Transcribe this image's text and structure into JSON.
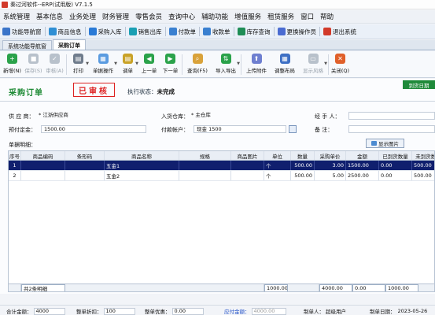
{
  "window": {
    "title": "秦过河软件--ERP(试用版) V7.1.5"
  },
  "menu": [
    "系统管理",
    "基本信息",
    "业务处理",
    "财务管理",
    "零售会员",
    "查询中心",
    "辅助功能",
    "增值服务",
    "租赁服务",
    "窗口",
    "帮助"
  ],
  "quickbar": [
    {
      "label": "功能导航窗",
      "icon": "grid-icon",
      "color": "#3a74c9"
    },
    {
      "label": "商品信息",
      "icon": "product-icon",
      "color": "#2f8fd4"
    },
    {
      "label": "采购入库",
      "icon": "purchase-in-icon",
      "color": "#2a7ad6"
    },
    {
      "label": "销售出库",
      "icon": "sales-out-icon",
      "color": "#1a9fb3"
    },
    {
      "label": "付款单",
      "icon": "payment-icon",
      "color": "#3a80d0"
    },
    {
      "label": "收款单",
      "icon": "receipt-icon",
      "color": "#3a80d0"
    },
    {
      "label": "库存查询",
      "icon": "stock-query-icon",
      "color": "#1f8d55"
    },
    {
      "label": "更换操作员",
      "icon": "switch-user-icon",
      "color": "#4a6bd1"
    },
    {
      "label": "退出系统",
      "icon": "exit-icon",
      "color": "#d23a2a"
    }
  ],
  "tabs": [
    {
      "label": "系统功能导航窗"
    },
    {
      "label": "采购订单"
    }
  ],
  "toolbar": [
    {
      "label": "新增(N)",
      "icon": "add-icon",
      "color": "#2aa24a",
      "glyph": "+",
      "enabled": true
    },
    {
      "label": "保存(S)",
      "icon": "save-icon",
      "color": "#b8c1cb",
      "glyph": "■",
      "enabled": false
    },
    {
      "label": "审核(A)",
      "icon": "approve-icon",
      "color": "#b8c1cb",
      "glyph": "✓",
      "enabled": false
    },
    {
      "label": "打印",
      "icon": "print-icon",
      "color": "#6f7c8c",
      "glyph": "▤",
      "enabled": true,
      "dropdown": true
    },
    {
      "label": "单据操作",
      "icon": "document-ops-icon",
      "color": "#5a9be0",
      "glyph": "▦",
      "enabled": true,
      "dropdown": true,
      "wide": true
    },
    {
      "label": "调单",
      "icon": "retrieve-doc-icon",
      "color": "#c9a227",
      "glyph": "▤",
      "enabled": true,
      "dropdown": true
    },
    {
      "label": "上一单",
      "icon": "prev-icon",
      "color": "#2aa24a",
      "glyph": "◀",
      "enabled": true
    },
    {
      "label": "下一单",
      "icon": "next-icon",
      "color": "#2aa24a",
      "glyph": "▶",
      "enabled": true
    },
    {
      "label": "查询(F5)",
      "icon": "search-icon",
      "color": "#d9a23a",
      "glyph": "⌕",
      "enabled": true,
      "wide": true
    },
    {
      "label": "导入导出",
      "icon": "import-export-icon",
      "color": "#2aa24a",
      "glyph": "⇅",
      "enabled": true,
      "dropdown": true,
      "wide": true
    },
    {
      "label": "上传附件",
      "icon": "attachment-icon",
      "color": "#6e7fd0",
      "glyph": "⬆",
      "enabled": true,
      "wide": true
    },
    {
      "label": "调整布局",
      "icon": "layout-icon",
      "color": "#3d6fc4",
      "glyph": "▦",
      "enabled": true,
      "wide": true
    },
    {
      "label": "显示风格",
      "icon": "display-style-icon",
      "color": "#b8c1cb",
      "glyph": "▭",
      "enabled": false,
      "dropdown": true,
      "wide": true
    },
    {
      "label": "关闭(Q)",
      "icon": "close-icon",
      "color": "#e0602a",
      "glyph": "✕",
      "enabled": true
    }
  ],
  "order": {
    "title": "采购订单",
    "stamp": "已审核",
    "exec_status_label": "执行状态：",
    "exec_status_value": "未完成",
    "arrive_date_button": "到货日期"
  },
  "fields": {
    "supplier_label": "供 应 商：",
    "supplier_value": "江浙供应商",
    "warehouse_label": "入货仓库：",
    "warehouse_value": "主仓库",
    "handler_label": "经 手 人：",
    "handler_value": "",
    "prepay_label": "预付定金：",
    "prepay_value": "1500.00",
    "account_label": "付款帐户：",
    "account_value": "现金 1500",
    "remark_label": "备    注：",
    "remark_value": "",
    "required_mark": "*"
  },
  "table": {
    "label": "单据明细：",
    "show_image_button": "显示图片",
    "columns": [
      "序号",
      "商品编码",
      "条形码",
      "商品名称",
      "规格",
      "商品图片",
      "单位",
      "数量",
      "采购单价",
      "金额",
      "已到货数量",
      "未到货数量"
    ],
    "rows": [
      {
        "no": "1",
        "code": "",
        "barcode": "",
        "name": "五金1",
        "spec": "",
        "image": "",
        "unit": "个",
        "qty": "500.00",
        "price": "3.00",
        "amount": "1500.00",
        "arrived": "0.00",
        "pending": "500.00",
        "selected": true
      },
      {
        "no": "2",
        "code": "",
        "barcode": "",
        "name": "五金2",
        "spec": "",
        "image": "",
        "unit": "个",
        "qty": "500.00",
        "price": "5.00",
        "amount": "2500.00",
        "arrived": "0.00",
        "pending": "500.00",
        "selected": false
      }
    ],
    "footer": {
      "count": "共2条明细",
      "qty": "1000.00",
      "amount": "4000.00",
      "arrived": "0.00",
      "pending": "1000.00"
    }
  },
  "bottom": {
    "total_label": "合计金额：",
    "total_value": "4000",
    "discount_label": "整单折扣：",
    "discount_value": "100",
    "promo_label": "整单优惠：",
    "promo_value": "0.00",
    "payable_label": "应付金额：",
    "payable_value": "4000.00",
    "creator_label": "制单人：",
    "creator_value": "超级用户",
    "date_label": "制单日期：",
    "date_value": "2023-05-26"
  }
}
